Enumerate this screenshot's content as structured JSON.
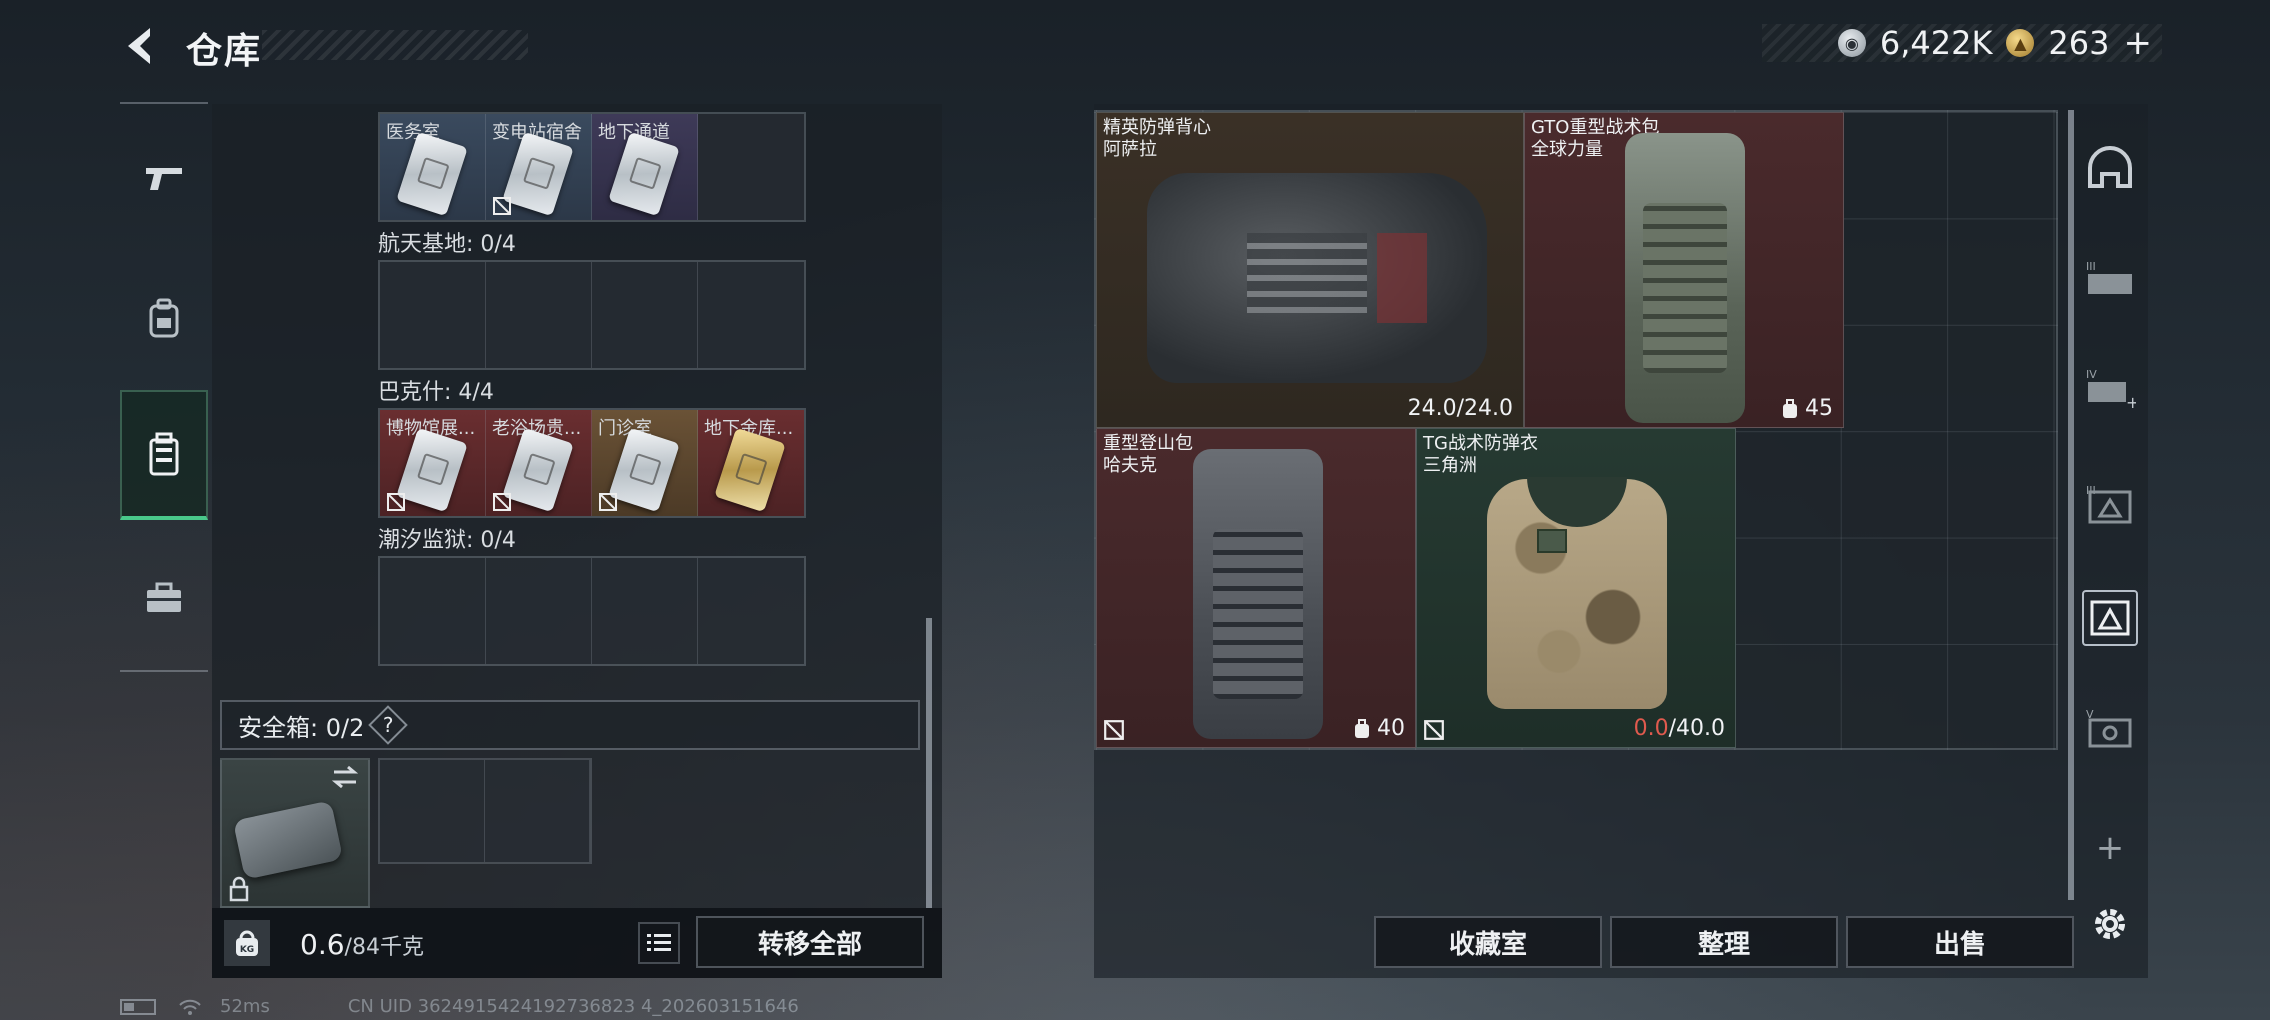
{
  "header": {
    "title": "仓库",
    "currency_silver": "6,422K",
    "currency_gold": "263",
    "add_label": "+"
  },
  "left_panel": {
    "top_row": [
      {
        "label": "医务室",
        "color": "blue"
      },
      {
        "label": "变电站宿舍",
        "color": "blue"
      },
      {
        "label": "地下通道",
        "color": "purple"
      },
      {
        "label": "",
        "color": "empty"
      }
    ],
    "groups": [
      {
        "label": "航天基地: 0/4"
      },
      {
        "label": "巴克什: 4/4"
      },
      {
        "label": "潮汐监狱: 0/4"
      }
    ],
    "bakshi_row": [
      {
        "label": "博物馆展..."
      },
      {
        "label": "老浴场贵..."
      },
      {
        "label": "门诊室"
      },
      {
        "label": "地下金库..."
      }
    ],
    "safe_box_label": "安全箱: 0/2",
    "safe_help": "?",
    "weight_current": "0.6",
    "weight_max": "/84千克",
    "weight_badge": "KG",
    "transfer_all": "转移全部"
  },
  "right_panel": {
    "items": [
      {
        "name_line1": "精英防弹背心",
        "name_line2": "阿萨拉",
        "meta": "24.0/24.0"
      },
      {
        "name_line1": "GTO重型战术包",
        "name_line2": "全球力量",
        "meta": "45"
      },
      {
        "name_line1": "重型登山包",
        "name_line2": "哈夫克",
        "meta": "40"
      },
      {
        "name_line1": "TG战术防弹衣",
        "name_line2": "三角洲",
        "meta_current": "0.0",
        "meta_max": "/40.0"
      }
    ],
    "buttons": {
      "collection": "收藏室",
      "organize": "整理",
      "sell": "出售"
    }
  },
  "filters": [
    "helmet-icon",
    "armor-iii-icon",
    "armor-iv-icon",
    "backpack-iii-icon",
    "backpack-active-icon",
    "backpack-v-icon",
    "add-icon",
    "gear-icon"
  ],
  "filter_labels": {
    "iii": "III",
    "iv": "IV",
    "v": "V",
    "add": "+"
  },
  "status": {
    "ping": "52ms",
    "uid": "CN UID 3624915424192736823 4_202603151646"
  },
  "colors": {
    "accent_green": "#49c98a",
    "durability_red": "#e05a4e"
  }
}
